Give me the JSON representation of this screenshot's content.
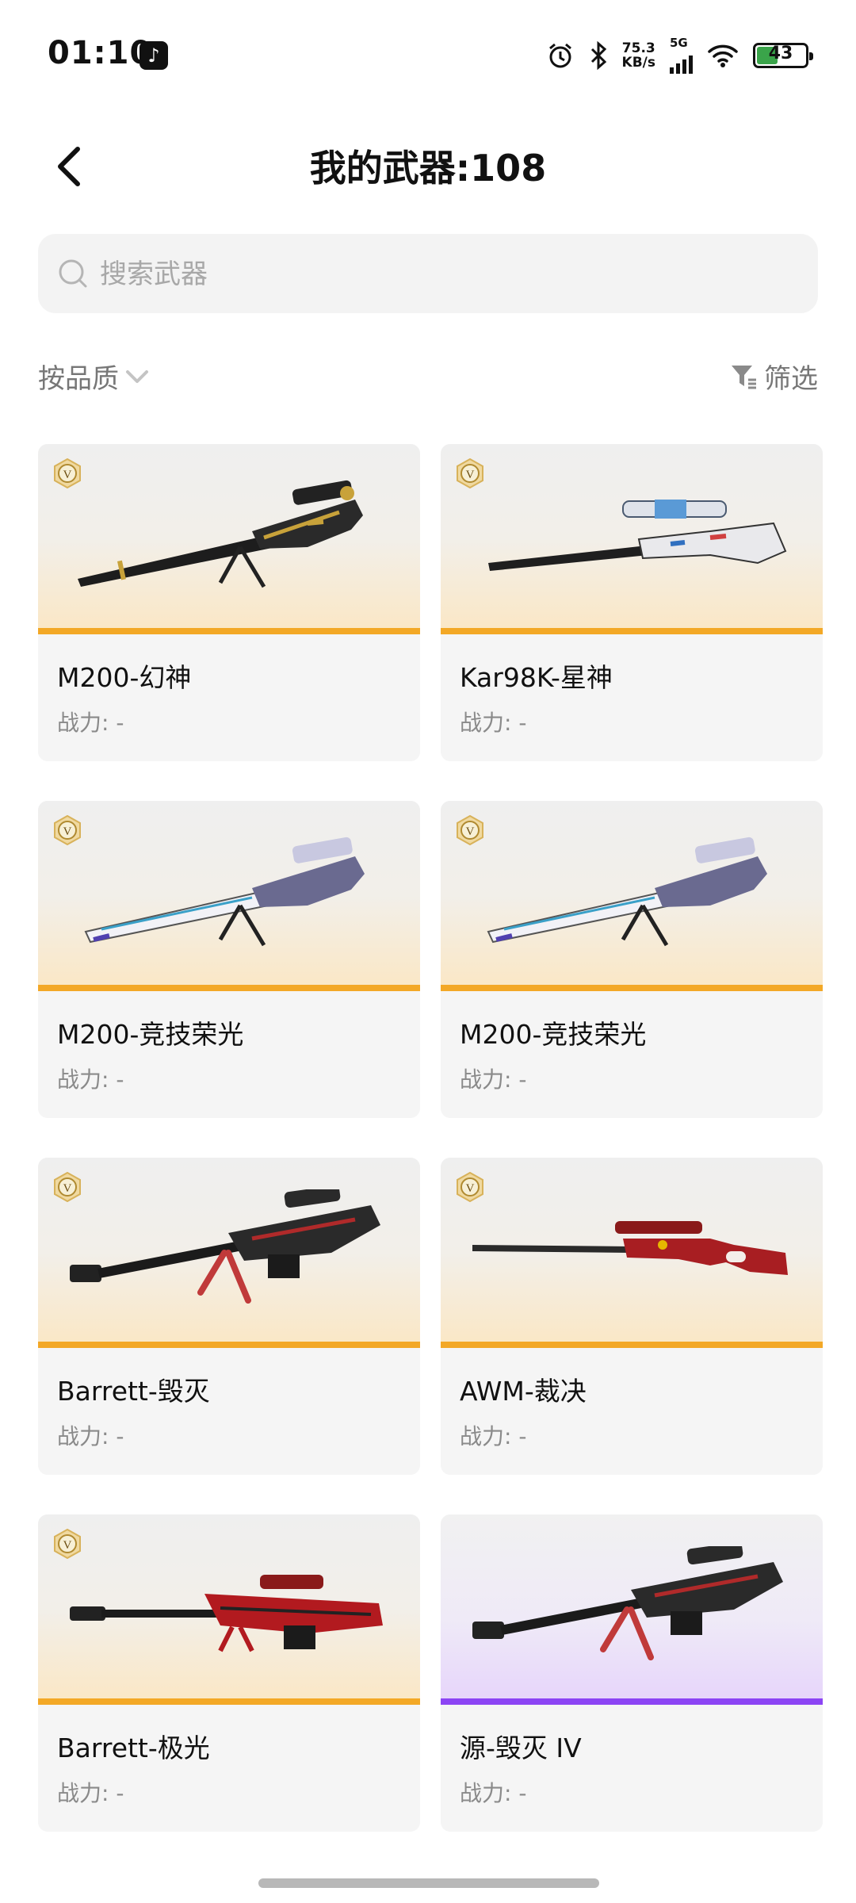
{
  "status_bar": {
    "time": "01:10",
    "net_speed_value": "75.3",
    "net_speed_unit": "KB/s",
    "signal_label": "5G",
    "battery": "43"
  },
  "header": {
    "title": "我的武器:108"
  },
  "search": {
    "placeholder": "搜索武器"
  },
  "toolbar": {
    "sort_label": "按品质",
    "filter_label": "筛选"
  },
  "weapons": [
    {
      "name": "M200-幻神",
      "power": "战力: -",
      "rarity": "gold"
    },
    {
      "name": "Kar98K-星神",
      "power": "战力: -",
      "rarity": "gold"
    },
    {
      "name": "M200-竞技荣光",
      "power": "战力: -",
      "rarity": "gold"
    },
    {
      "name": "M200-竞技荣光",
      "power": "战力: -",
      "rarity": "gold"
    },
    {
      "name": "Barrett-毁灭",
      "power": "战力: -",
      "rarity": "gold"
    },
    {
      "name": "AWM-裁决",
      "power": "战力: -",
      "rarity": "gold"
    },
    {
      "name": "Barrett-极光",
      "power": "战力: -",
      "rarity": "gold"
    },
    {
      "name": "源-毁灭 IV",
      "power": "战力: -",
      "rarity": "purple"
    }
  ],
  "colors": {
    "gold_bar": "#f3a826",
    "purple_bar": "#8c44f4"
  }
}
